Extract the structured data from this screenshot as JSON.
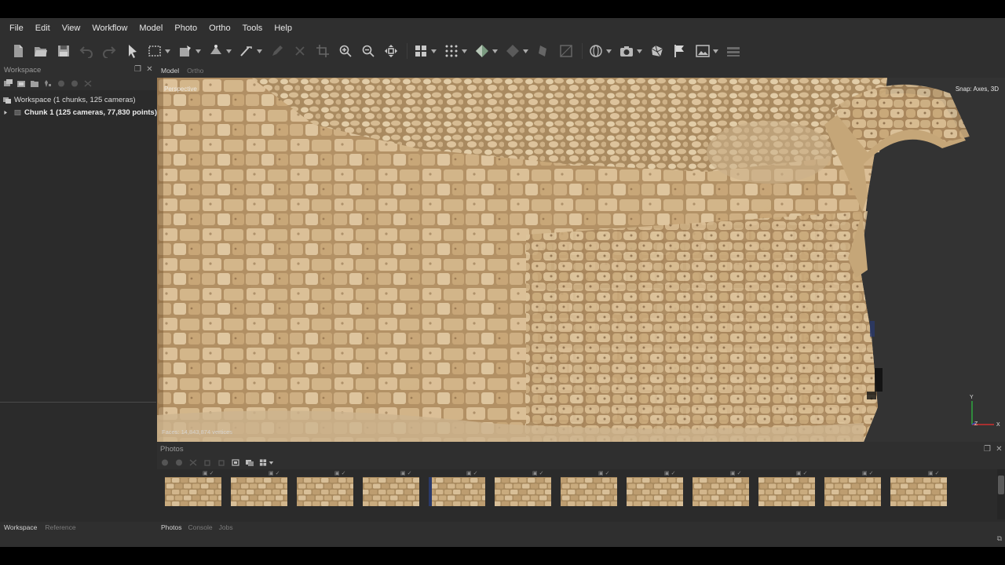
{
  "menu": [
    "File",
    "Edit",
    "View",
    "Workflow",
    "Model",
    "Photo",
    "Ortho",
    "Tools",
    "Help"
  ],
  "workspace": {
    "title": "Workspace",
    "root_label": "Workspace (1 chunks, 125 cameras)",
    "chunk_label": "Chunk 1 (125 cameras, 77,830 points)"
  },
  "view_tabs": {
    "model": "Model",
    "ortho": "Ortho"
  },
  "viewport": {
    "projection_label": "Perspective",
    "snap_label": "Snap: Axes, 3D",
    "stats_label": "Faces: 14,843,874 vertices",
    "axis_labels": {
      "y": "Y",
      "z": "Z",
      "x": "X"
    }
  },
  "photos": {
    "title": "Photos",
    "count_visible": 12
  },
  "left_tabs": {
    "workspace": "Workspace",
    "reference": "Reference"
  },
  "bottom_tabs": {
    "photos": "Photos",
    "console": "Console",
    "jobs": "Jobs"
  },
  "colors": {
    "app_bg": "#2f2f2f",
    "panel_bg": "#2b2b2b",
    "stone_light": "#d9bf97",
    "stone_mid": "#c2a273",
    "stone_dark": "#8a6a45",
    "axis_x": "#d03030",
    "axis_y": "#30b040"
  },
  "icons": [
    "new-icon",
    "open-icon",
    "save-icon",
    "undo-icon",
    "redo-icon",
    "navigation-icon",
    "rectangle-selection-icon",
    "shape-icon",
    "ruler-icon",
    "draw-icon",
    "delete-icon",
    "crop-icon",
    "zoom-in-icon",
    "zoom-out-icon",
    "move-object-icon",
    "show-cameras-icon",
    "show-points-icon",
    "show-model-icon",
    "show-shapes-icon",
    "show-markers-icon",
    "show-region-icon",
    "texture-icon",
    "camera-capture-icon",
    "mesh-icon",
    "flag-icon",
    "image-icon",
    "layers-icon"
  ]
}
